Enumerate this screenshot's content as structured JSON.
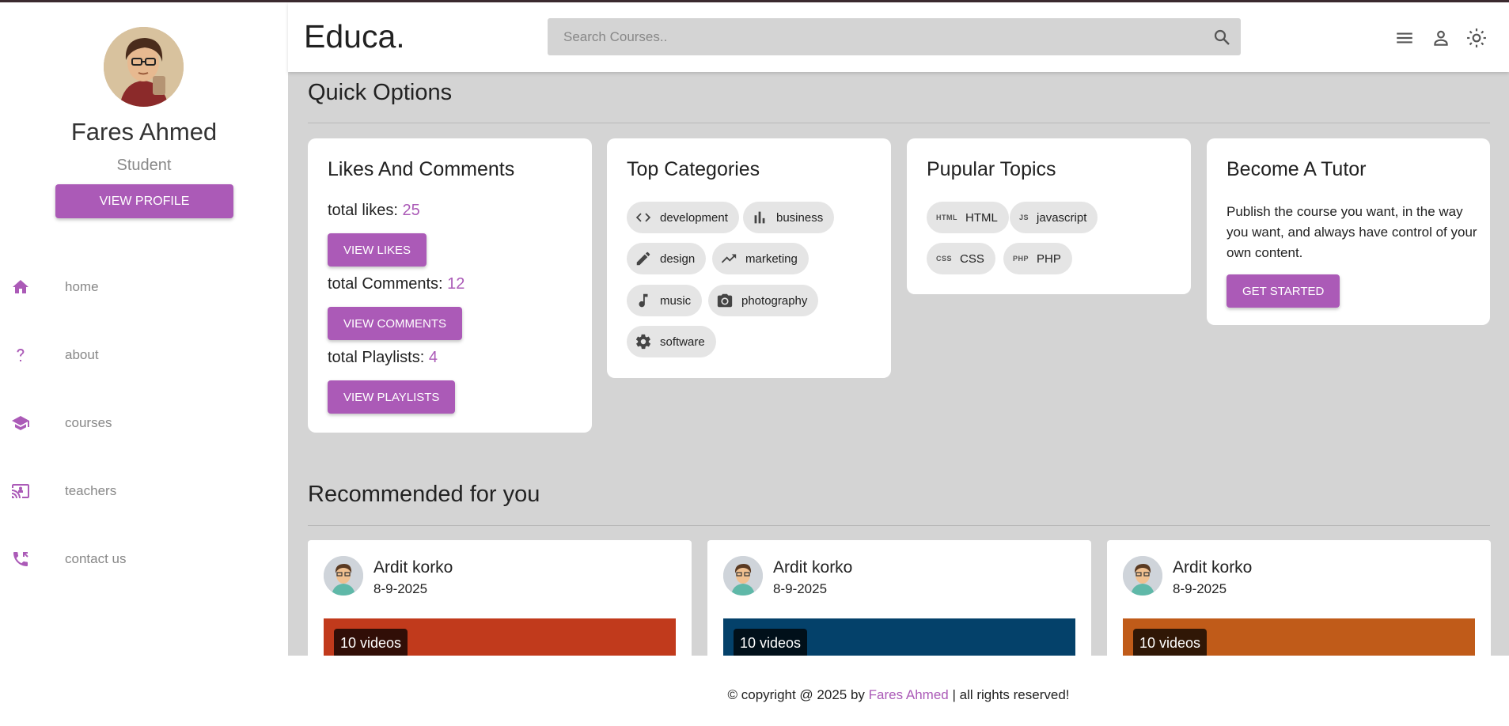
{
  "app": {
    "logo": "Educa."
  },
  "profile": {
    "name": "Fares Ahmed",
    "role": "Student",
    "view_label": "VIEW PROFILE"
  },
  "nav": [
    {
      "label": "home",
      "icon": "home-icon"
    },
    {
      "label": "about",
      "icon": "question-icon"
    },
    {
      "label": "courses",
      "icon": "graduation-cap-icon"
    },
    {
      "label": "teachers",
      "icon": "presentation-icon"
    },
    {
      "label": "contact us",
      "icon": "phone-icon"
    }
  ],
  "search": {
    "placeholder": "Search Courses.."
  },
  "quick": {
    "title": "Quick Options",
    "likes_card": {
      "title": "Likes And Comments",
      "likes_label": "total likes: ",
      "likes_value": "25",
      "likes_button": "VIEW LIKES",
      "comments_label": "total Comments: ",
      "comments_value": "12",
      "comments_button": "VIEW COMMENTS",
      "playlists_label": "total Playlists: ",
      "playlists_value": "4",
      "playlists_button": "VIEW PLAYLISTS"
    },
    "categories": {
      "title": "Top Categories",
      "items": [
        "development",
        "business",
        "design",
        "marketing",
        "music",
        "photography",
        "software"
      ]
    },
    "topics": {
      "title": "Pupular Topics",
      "items": [
        {
          "tag": "HTML",
          "label": "HTML"
        },
        {
          "tag": "JS",
          "label": "javascript"
        },
        {
          "tag": "CSS",
          "label": "CSS"
        },
        {
          "tag": "PHP",
          "label": "PHP"
        }
      ]
    },
    "tutor": {
      "title": "Become A Tutor",
      "text": "Publish the course you want, in the way you want, and always have control of your own content.",
      "button": "GET STARTED"
    }
  },
  "recommended": {
    "title": "Recommended for you",
    "cards": [
      {
        "name": "Ardit korko",
        "date": "8-9-2025",
        "videos": "10 videos",
        "color": "#c13a1c"
      },
      {
        "name": "Ardit korko",
        "date": "8-9-2025",
        "videos": "10 videos",
        "color": "#04416a"
      },
      {
        "name": "Ardit korko",
        "date": "8-9-2025",
        "videos": "10 videos",
        "color": "#c05b19"
      }
    ]
  },
  "footer": {
    "prefix": "© copyright @ 2025 by ",
    "author": "Fares Ahmed",
    "suffix": " | all rights reserved!"
  },
  "colors": {
    "accent": "#ab5ab7",
    "background": "#d4d4d4"
  }
}
